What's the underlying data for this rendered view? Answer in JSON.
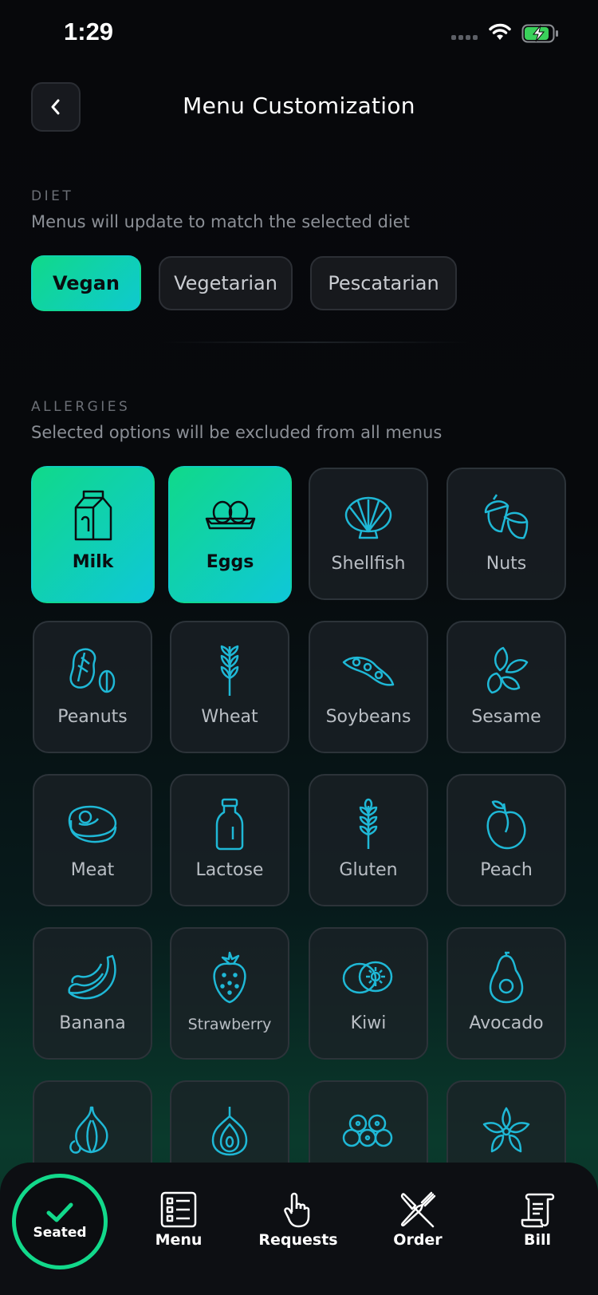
{
  "status": {
    "time": "1:29"
  },
  "header": {
    "title": "Menu Customization"
  },
  "diet": {
    "label": "DIET",
    "subtitle": "Menus will update to match the selected diet",
    "options": [
      "Vegan",
      "Vegetarian",
      "Pescatarian"
    ],
    "selected": "Vegan"
  },
  "allergies": {
    "label": "ALLERGIES",
    "subtitle": "Selected options will be excluded from all menus",
    "items": [
      {
        "label": "Milk",
        "icon": "milk-carton-icon",
        "selected": true
      },
      {
        "label": "Eggs",
        "icon": "eggs-icon",
        "selected": true
      },
      {
        "label": "Shellfish",
        "icon": "shell-icon",
        "selected": false
      },
      {
        "label": "Nuts",
        "icon": "acorn-icon",
        "selected": false
      },
      {
        "label": "Peanuts",
        "icon": "peanut-icon",
        "selected": false
      },
      {
        "label": "Wheat",
        "icon": "wheat-icon",
        "selected": false
      },
      {
        "label": "Soybeans",
        "icon": "soybean-icon",
        "selected": false
      },
      {
        "label": "Sesame",
        "icon": "sesame-icon",
        "selected": false
      },
      {
        "label": "Meat",
        "icon": "steak-icon",
        "selected": false
      },
      {
        "label": "Lactose",
        "icon": "milk-bottle-icon",
        "selected": false
      },
      {
        "label": "Gluten",
        "icon": "grain-icon",
        "selected": false
      },
      {
        "label": "Peach",
        "icon": "peach-icon",
        "selected": false
      },
      {
        "label": "Banana",
        "icon": "banana-icon",
        "selected": false
      },
      {
        "label": "Strawberry",
        "icon": "strawberry-icon",
        "selected": false
      },
      {
        "label": "Kiwi",
        "icon": "kiwi-icon",
        "selected": false
      },
      {
        "label": "Avocado",
        "icon": "avocado-icon",
        "selected": false
      },
      {
        "label": "",
        "icon": "garlic-icon",
        "selected": false
      },
      {
        "label": "",
        "icon": "onion-icon",
        "selected": false
      },
      {
        "label": "",
        "icon": "berries-icon",
        "selected": false
      },
      {
        "label": "",
        "icon": "star-anise-icon",
        "selected": false
      }
    ]
  },
  "nav": {
    "seated": "Seated",
    "menu": "Menu",
    "requests": "Requests",
    "order": "Order",
    "bill": "Bill"
  },
  "colors": {
    "accent": "#12d98b",
    "accent2": "#0fc9cf",
    "icon": "#1fb8d6"
  }
}
